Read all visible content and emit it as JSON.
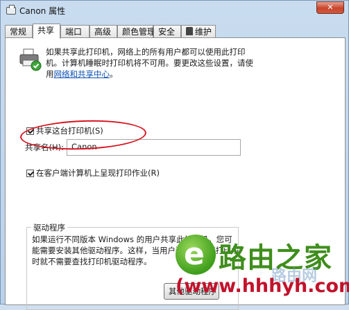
{
  "window": {
    "title": "Canon 属性",
    "close_label": "✕"
  },
  "tabs": [
    {
      "label": "常规"
    },
    {
      "label": "共享"
    },
    {
      "label": "端口"
    },
    {
      "label": "高级"
    },
    {
      "label": "颜色管理"
    },
    {
      "label": "安全"
    },
    {
      "label": "维护"
    }
  ],
  "share": {
    "intro_text": "如果共享此打印机，网络上的所有用户都可以使用此打印机。计算机睡眠时打印机将不可用。要更改这些设置，请使用",
    "link_text": "网络和共享中心",
    "link_suffix": "。",
    "share_checkbox_label": "共享这台打印机(S)",
    "share_name_label": "共享名(H):",
    "share_name_value": "Canon",
    "render_checkbox_label": "在客户端计算机上呈现打印作业(R)"
  },
  "drivers": {
    "title": "驱动程序",
    "text": "如果运行不同版本 Windows 的用户共享此打印机，您可能需要安装其他驱动程序。这样，当用户连接到共享打印机时就不需要查找打印机驱动程序。",
    "other_button_label": "其他驱动程序(D)..."
  },
  "watermark": {
    "brand": "路由之家",
    "sub": "路由网",
    "url": "(www.hhhyh.com)"
  },
  "icons": {
    "printer": "printer-share-icon",
    "tab_maintenance": "maintenance-icon"
  }
}
